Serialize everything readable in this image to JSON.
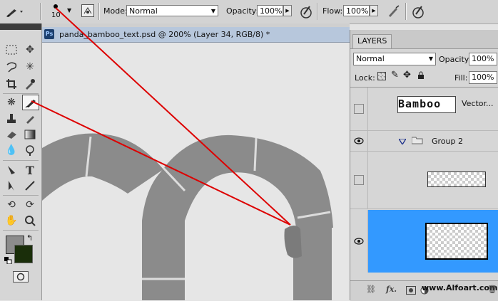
{
  "options_bar": {
    "brush_size": "10",
    "mode_label": "Mode:",
    "mode_value": "Normal",
    "opacity_label": "Opacity:",
    "opacity_value": "100%",
    "flow_label": "Flow:",
    "flow_value": "100%"
  },
  "document": {
    "ps_badge": "Ps",
    "tab_title": "panda_bamboo_text.psd @ 200% (Layer 34, RGB/8) *"
  },
  "layers_panel": {
    "title": "LAYERS",
    "blend_mode": "Normal",
    "opacity_label": "Opacity:",
    "opacity_value": "100%",
    "lock_label": "Lock:",
    "fill_label": "Fill:",
    "fill_value": "100%",
    "layers": [
      {
        "name": "Vector...",
        "thumb_text": "Bamboo",
        "visible": false
      },
      {
        "name": "Group 2",
        "visible": true
      },
      {
        "name": "",
        "visible": false
      },
      {
        "name": "",
        "visible": true,
        "selected": true
      }
    ],
    "selected_color": "#3399ff"
  },
  "watermark": "www.Alfoart.com",
  "colors": {
    "foreground": "#8c8c8c",
    "background": "#1a2e0a",
    "annotation": "#dd0000",
    "bamboo": "#8a8a8a"
  }
}
